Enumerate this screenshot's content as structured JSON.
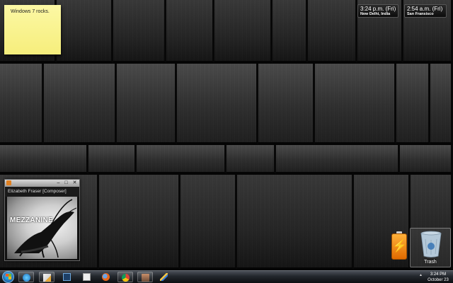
{
  "sticky_note": {
    "text": "Windows 7 rocks."
  },
  "clocks": [
    {
      "time": "3:24 p.m. (Fri)",
      "city": "New Delhi, India"
    },
    {
      "time": "2:54 a.m. (Fri)",
      "city": "San Fransisco"
    }
  ],
  "media_player": {
    "artist": "Elizabeth Fraser [Composer]",
    "album_title": "MEZZANINE",
    "controls": {
      "minimize": "–",
      "restore": "□",
      "close": "✕"
    }
  },
  "desktop": {
    "trash_label": "Trash"
  },
  "taskbar": {
    "pinned_icons": [
      "start-orb",
      "media-player-icon",
      "paint-icon",
      "photoshop-icon",
      "notepad-icon",
      "firefox-icon",
      "chrome-icon",
      "contacts-icon",
      "pen-tool-icon"
    ],
    "tray_arrow": "▲",
    "clock_time": "3:24 PM",
    "clock_date": "October 23"
  },
  "colors": {
    "sticky_note": "#f8f08a",
    "taskbar": "#1c1f24",
    "battery": "#f59a1a"
  }
}
